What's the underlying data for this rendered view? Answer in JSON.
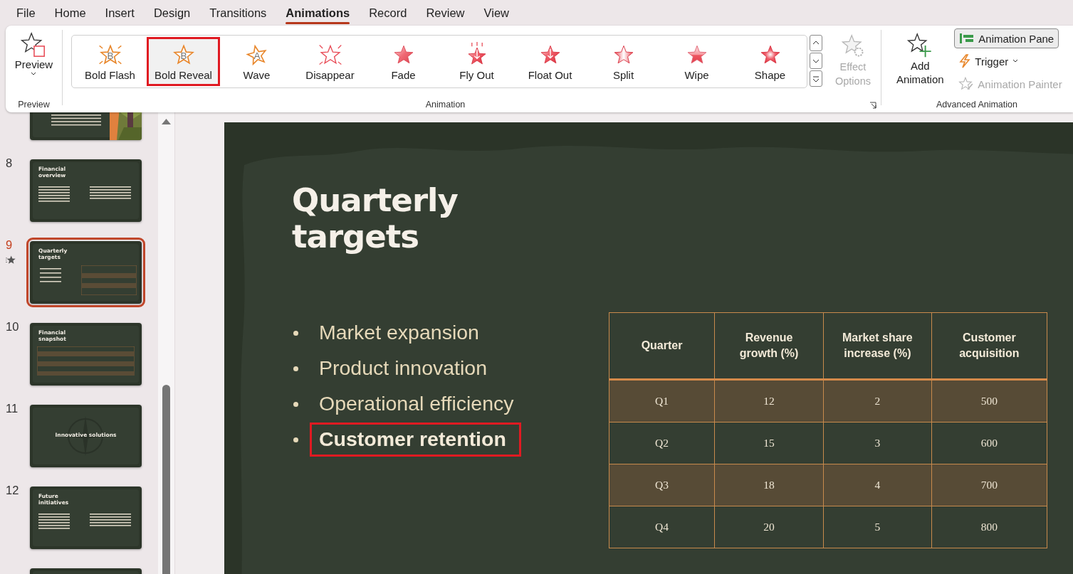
{
  "tabs": [
    {
      "label": "File",
      "selected": false
    },
    {
      "label": "Home",
      "selected": false
    },
    {
      "label": "Insert",
      "selected": false
    },
    {
      "label": "Design",
      "selected": false
    },
    {
      "label": "Transitions",
      "selected": false
    },
    {
      "label": "Animations",
      "selected": true
    },
    {
      "label": "Record",
      "selected": false
    },
    {
      "label": "Review",
      "selected": false
    },
    {
      "label": "View",
      "selected": false
    }
  ],
  "ribbon": {
    "preview": {
      "label": "Preview",
      "group": "Preview"
    },
    "animations": [
      {
        "label": "Bold Flash",
        "kind": "bold-flash",
        "glyph": "B",
        "selected": false
      },
      {
        "label": "Bold Reveal",
        "kind": "bold-reveal",
        "glyph": "B",
        "selected": true
      },
      {
        "label": "Wave",
        "kind": "wave",
        "glyph": "A",
        "selected": false
      },
      {
        "label": "Disappear",
        "kind": "disappear",
        "selected": false
      },
      {
        "label": "Fade",
        "kind": "fade",
        "selected": false
      },
      {
        "label": "Fly Out",
        "kind": "fly-out",
        "selected": false
      },
      {
        "label": "Float Out",
        "kind": "float-out",
        "selected": false
      },
      {
        "label": "Split",
        "kind": "split",
        "selected": false
      },
      {
        "label": "Wipe",
        "kind": "wipe",
        "selected": false
      },
      {
        "label": "Shape",
        "kind": "shape",
        "selected": false
      }
    ],
    "effect_options": {
      "label": "Effect Options",
      "disabled": true
    },
    "animation_group": "Animation",
    "add_animation": {
      "label": "Add Animation"
    },
    "animation_pane": {
      "label": "Animation Pane",
      "on": true
    },
    "trigger": {
      "label": "Trigger",
      "disabled": false
    },
    "animation_painter": {
      "label": "Animation Painter",
      "disabled": true
    },
    "advanced_group": "Advanced Animation"
  },
  "slides": [
    {
      "kind": "partial-top",
      "selected": false,
      "animated": false
    },
    {
      "number": "8",
      "title": "Financial overview",
      "kind": "two-column",
      "selected": false,
      "animated": false
    },
    {
      "number": "9",
      "title": "Quarterly targets",
      "kind": "bullets-table",
      "selected": true,
      "animated": true
    },
    {
      "number": "10",
      "title": "Financial snapshot",
      "kind": "table",
      "selected": false,
      "animated": false
    },
    {
      "number": "11",
      "title": "Innovative solutions",
      "kind": "section",
      "selected": false,
      "animated": false
    },
    {
      "number": "12",
      "title": "Future initiatives",
      "kind": "two-column",
      "selected": false,
      "animated": false
    },
    {
      "kind": "partial-bottom",
      "selected": false,
      "animated": false
    }
  ],
  "slide": {
    "title": "Quarterly targets",
    "bullets": [
      {
        "text": "Market expansion",
        "bold": false,
        "highlighted": false
      },
      {
        "text": "Product innovation",
        "bold": false,
        "highlighted": false
      },
      {
        "text": "Operational efficiency",
        "bold": false,
        "highlighted": false
      },
      {
        "text": "Customer retention",
        "bold": true,
        "highlighted": true
      }
    ],
    "table": {
      "columns": [
        "Quarter",
        "Revenue growth (%)",
        "Market share increase (%)",
        "Customer acquisition"
      ],
      "rows": [
        [
          "Q1",
          "12",
          "2",
          "500"
        ],
        [
          "Q2",
          "15",
          "3",
          "600"
        ],
        [
          "Q3",
          "18",
          "4",
          "700"
        ],
        [
          "Q4",
          "20",
          "5",
          "800"
        ]
      ]
    }
  }
}
